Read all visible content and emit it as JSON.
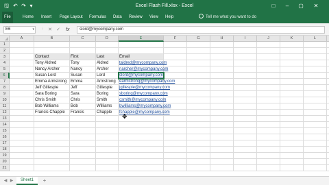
{
  "window": {
    "title": "Excel Flash Fill.xlsx - Excel"
  },
  "ribbon": {
    "tabs": [
      "File",
      "Home",
      "Insert",
      "Page Layout",
      "Formulas",
      "Data",
      "Review",
      "View",
      "Help"
    ],
    "tell_me": "Tell me what you want to do"
  },
  "formula_bar": {
    "name_box": "E6",
    "formula": "slord@mycompany.com",
    "fx_label": "fx"
  },
  "grid": {
    "columns": [
      "A",
      "B",
      "C",
      "D",
      "E",
      "F",
      "G",
      "H",
      "I",
      "J",
      "K",
      "L",
      "M",
      "N"
    ],
    "rows": [
      "1",
      "2",
      "3",
      "4",
      "5",
      "6",
      "7",
      "8",
      "9",
      "10",
      "11",
      "12",
      "13",
      "14",
      "15",
      "16",
      "17",
      "18",
      "19",
      "20",
      "21"
    ],
    "selected_column": "E",
    "selected_row": "6",
    "headers": [
      "Contact",
      "First",
      "Last",
      "Email"
    ],
    "data": [
      [
        "Tony Aldred",
        "Tony",
        "Aldred",
        "taldred@mycompany.com"
      ],
      [
        "Nancy Archer",
        "Nancy",
        "Archer",
        "narcher@mycompany.com"
      ],
      [
        "Susan Lord",
        "Susan",
        "Lord",
        "slord@mycompany.com"
      ],
      [
        "Emma Armstrong",
        "Emma",
        "Armstrong",
        "earmstrong@mycompany.com"
      ],
      [
        "Jeff Gillespie",
        "Jeff",
        "Gillespie",
        "jgillespie@mycompany.com"
      ],
      [
        "Sara Boring",
        "Sara",
        "Boring",
        "sboring@mycompany.com"
      ],
      [
        "Chris Smith",
        "Chris",
        "Smith",
        "csmith@mycompany.com"
      ],
      [
        "Bob Williams",
        "Bob",
        "Williams",
        "bwilliams@mycompany.com"
      ],
      [
        "Francis Chapple",
        "Francis",
        "Chapple",
        "fchapple@mycompany.com"
      ]
    ]
  },
  "sheets": {
    "active": "Sheet1",
    "add_label": "+"
  }
}
